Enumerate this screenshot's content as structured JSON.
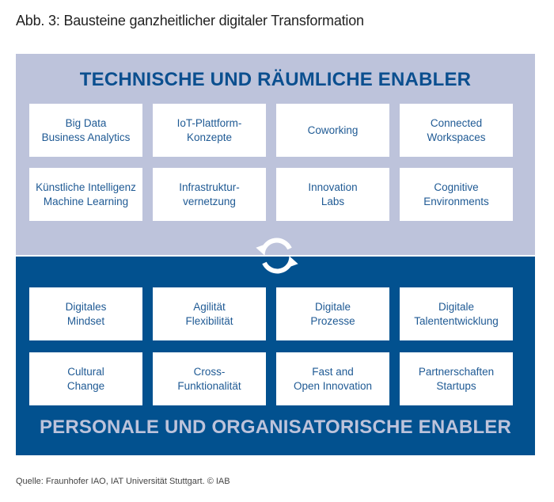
{
  "caption": "Abb. 3: Bausteine ganzheitlicher digitaler Transformation",
  "top_panel": {
    "heading": "TECHNISCHE UND RÄUMLICHE ENABLER",
    "color": "#bdc3db",
    "items": [
      "Big Data\nBusiness Analytics",
      "IoT-Plattform-\nKonzepte",
      "Coworking",
      "Connected\nWorkspaces",
      "Künstliche Intelligenz\nMachine Learning",
      "Infrastruktur-\nvernetzung",
      "Innovation\nLabs",
      "Cognitive\nEnvironments"
    ]
  },
  "bottom_panel": {
    "heading": "PERSONALE UND ORGANISATORISCHE ENABLER",
    "color": "#02518f",
    "items": [
      "Digitales\nMindset",
      "Agilität\nFlexibilität",
      "Digitale\nProzesse",
      "Digitale\nTalententwicklung",
      "Cultural\nChange",
      "Cross-\nFunktionalität",
      "Fast and\nOpen Innovation",
      "Partnerschaften\nStartups"
    ]
  },
  "connector_icon": "cycle-arrows-icon",
  "source": "Quelle: Fraunhofer IAO, IAT Universität Stuttgart. © IAB"
}
